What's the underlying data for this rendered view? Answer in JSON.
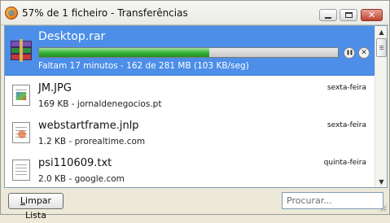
{
  "window": {
    "title": "57% de 1 ficheiro - Transferências",
    "close_glyph": "✕"
  },
  "downloads": [
    {
      "name": "Desktop.rar",
      "status": "Faltam 17 minutos - 162 de 281 MB (103 KB/seg)",
      "progress": 0.57,
      "icon": "rar-archive-icon",
      "active": true
    },
    {
      "name": "JM.JPG",
      "status": "169 KB - jornaldenegocios.pt",
      "date": "sexta-feira",
      "icon": "jpg-file-icon"
    },
    {
      "name": "webstartframe.jnlp",
      "status": "1.2 KB - prorealtime.com",
      "date": "sexta-feira",
      "icon": "jnlp-file-icon"
    },
    {
      "name": "psi110609.txt",
      "status": "2.0 KB - google.com",
      "date": "quinta-feira",
      "icon": "txt-file-icon"
    }
  ],
  "controls": {
    "pause_glyph": "❚❚",
    "cancel_glyph": "✕"
  },
  "footer": {
    "clear_label_underlined": "L",
    "clear_label_rest": "impar Lista",
    "search_placeholder": "Procurar..."
  },
  "colors": {
    "selection": "#4c8ee8",
    "progress": "#38b43a"
  }
}
